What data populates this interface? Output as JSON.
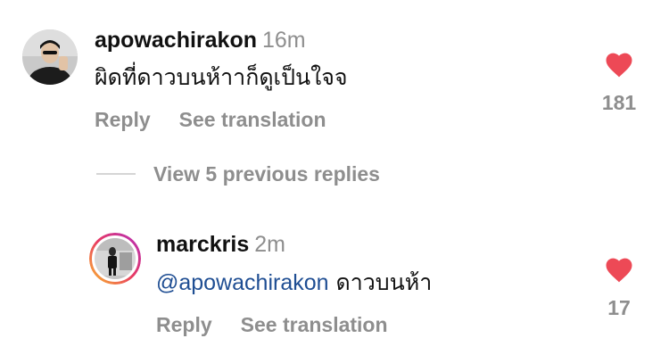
{
  "comments": [
    {
      "username": "apowachirakon",
      "timestamp": "16m",
      "text": "ผิดที่ดาวบนห้าาก็ดูเป็นใจจ",
      "reply_label": "Reply",
      "translate_label": "See translation",
      "like_count": "181",
      "like_icon": "heart-filled-icon",
      "like_color": "#ed4956"
    }
  ],
  "view_replies_label": "View 5 previous replies",
  "replies": [
    {
      "username": "marckris",
      "timestamp": "2m",
      "mention": "@apowachirakon",
      "text": "ดาวบนห้า",
      "reply_label": "Reply",
      "translate_label": "See translation",
      "like_count": "17",
      "like_icon": "heart-filled-icon",
      "like_color": "#ed4956",
      "story_ring": true
    }
  ]
}
